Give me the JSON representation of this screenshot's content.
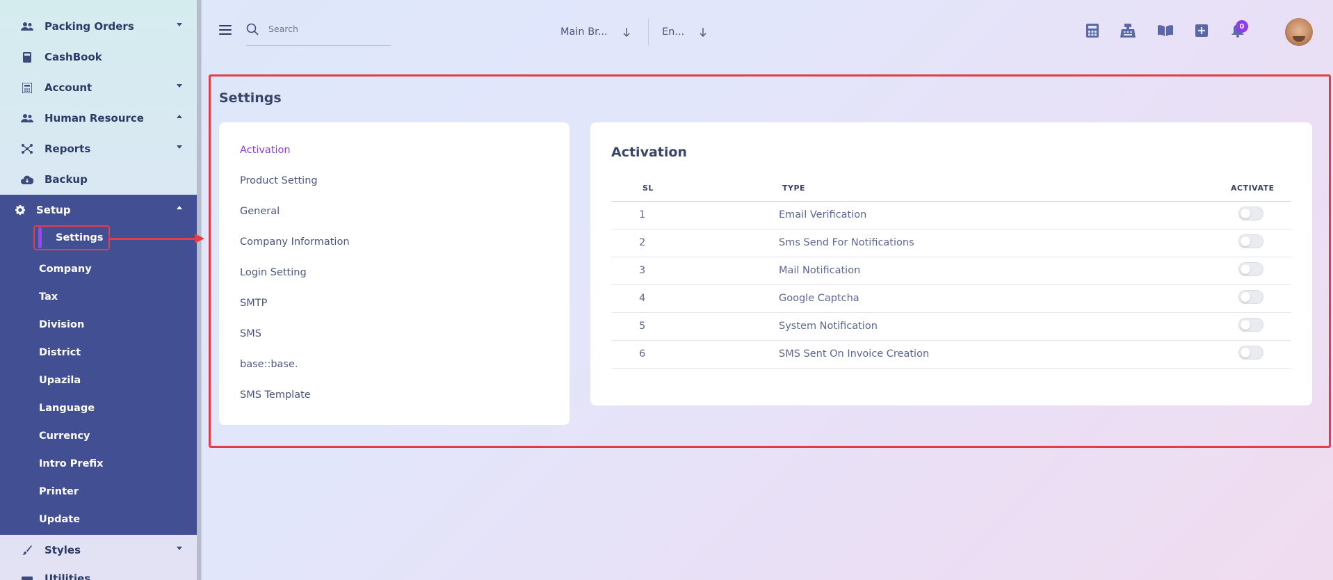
{
  "sidebar": {
    "items": [
      {
        "label": "Packing Orders",
        "icon": "users-icon"
      },
      {
        "label": "CashBook",
        "icon": "book-icon"
      },
      {
        "label": "Account",
        "icon": "calculator-icon"
      },
      {
        "label": "Human Resource",
        "icon": "users-icon"
      },
      {
        "label": "Reports",
        "icon": "chart-icon"
      },
      {
        "label": "Backup",
        "icon": "cloud-download-icon"
      }
    ],
    "setup": {
      "label": "Setup",
      "active_sub": "Settings",
      "subs": [
        "Company",
        "Tax",
        "Division",
        "District",
        "Upazila",
        "Language",
        "Currency",
        "Intro Prefix",
        "Printer",
        "Update"
      ]
    },
    "styles_label": "Styles",
    "partial_bottom": "Utilities"
  },
  "header": {
    "search_placeholder": "Search",
    "branch": "Main Br...",
    "language": "En...",
    "notification_count": "0"
  },
  "page": {
    "title": "Settings",
    "menu": [
      "Activation",
      "Product Setting",
      "General",
      "Company Information",
      "Login Setting",
      "SMTP",
      "SMS",
      "base::base.",
      "SMS Template"
    ],
    "active_menu": "Activation"
  },
  "activation": {
    "title": "Activation",
    "columns": [
      "SL",
      "TYPE",
      "ACTIVATE"
    ],
    "rows": [
      {
        "sl": "1",
        "type": "Email Verification",
        "active": false
      },
      {
        "sl": "2",
        "type": "Sms Send For Notifications",
        "active": false
      },
      {
        "sl": "3",
        "type": "Mail Notification",
        "active": false
      },
      {
        "sl": "4",
        "type": "Google Captcha",
        "active": false
      },
      {
        "sl": "5",
        "type": "System Notification",
        "active": false
      },
      {
        "sl": "6",
        "type": "SMS Sent On Invoice Creation",
        "active": false
      }
    ]
  },
  "colors": {
    "accent": "#8a3ff0",
    "sidebar_active": "#424f93",
    "highlight": "#e33d4a"
  }
}
